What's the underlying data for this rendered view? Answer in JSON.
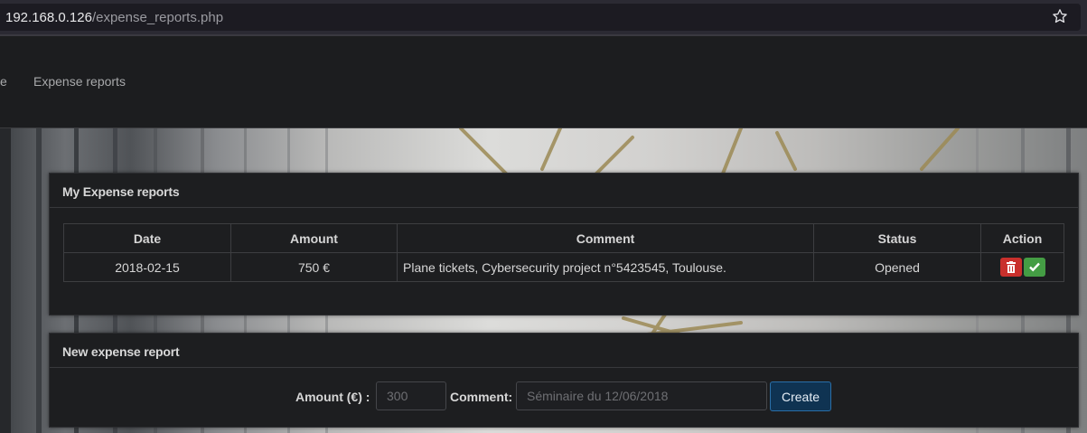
{
  "browser": {
    "url_host": "192.168.0.126",
    "url_path": "/expense_reports.php"
  },
  "nav": {
    "items": [
      {
        "label": "e"
      },
      {
        "label": "Expense reports"
      }
    ]
  },
  "my_reports": {
    "title": "My Expense reports",
    "columns": [
      "Date",
      "Amount",
      "Comment",
      "Status",
      "Action"
    ],
    "rows": [
      {
        "date": "2018-02-15",
        "amount": "750 €",
        "comment": "Plane tickets, Cybersecurity project n°5423545, Toulouse.",
        "status": "Opened"
      }
    ]
  },
  "new_report": {
    "title": "New expense report",
    "amount_label": "Amount (€) :",
    "amount_placeholder": "300",
    "comment_label": "Comment:",
    "comment_placeholder": "Séminaire du 12/06/2018",
    "create_label": "Create"
  },
  "colors": {
    "delete": "#c9302c",
    "validate": "#449d44",
    "create": "#0f3352"
  }
}
